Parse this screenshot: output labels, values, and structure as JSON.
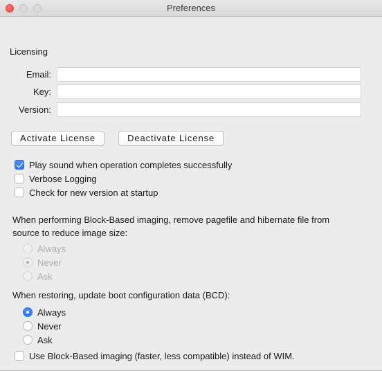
{
  "window": {
    "title": "Preferences",
    "controls": {
      "close": "close-button",
      "minimize": "minimize-button",
      "maximize": "maximize-button"
    },
    "accent_color": "#2f78ee",
    "background_color": "#ececec",
    "close_color": "#fc5c55"
  },
  "licensing": {
    "section_label": "Licensing",
    "fields": [
      {
        "label": "Email:",
        "value": "",
        "placeholder": ""
      },
      {
        "label": "Key:",
        "value": "",
        "placeholder": ""
      },
      {
        "label": "Version:",
        "value": "",
        "placeholder": ""
      }
    ],
    "buttons": [
      {
        "label": "Activate  License"
      },
      {
        "label": "Deactivate  License"
      }
    ]
  },
  "options": {
    "checkboxes": [
      {
        "label": "Play sound when operation completes successfully",
        "checked": true
      },
      {
        "label": "Verbose Logging",
        "checked": false
      },
      {
        "label": "Check for new version at startup",
        "checked": false
      }
    ]
  },
  "pagefile_group": {
    "description": "When performing Block-Based imaging, remove pagefile and hibernate file from source to reduce image size:",
    "enabled": false,
    "selected": "Never",
    "options": [
      {
        "label": "Always",
        "selected": false
      },
      {
        "label": "Never",
        "selected": true
      },
      {
        "label": "Ask",
        "selected": false
      }
    ]
  },
  "bcd_group": {
    "description": "When restoring, update boot configuration data (BCD):",
    "enabled": true,
    "selected": "Always",
    "options": [
      {
        "label": "Always",
        "selected": true
      },
      {
        "label": "Never",
        "selected": false
      },
      {
        "label": "Ask",
        "selected": false
      }
    ]
  },
  "block_based": {
    "label": "Use Block-Based imaging (faster, less compatible) instead of WIM.",
    "checked": false
  }
}
